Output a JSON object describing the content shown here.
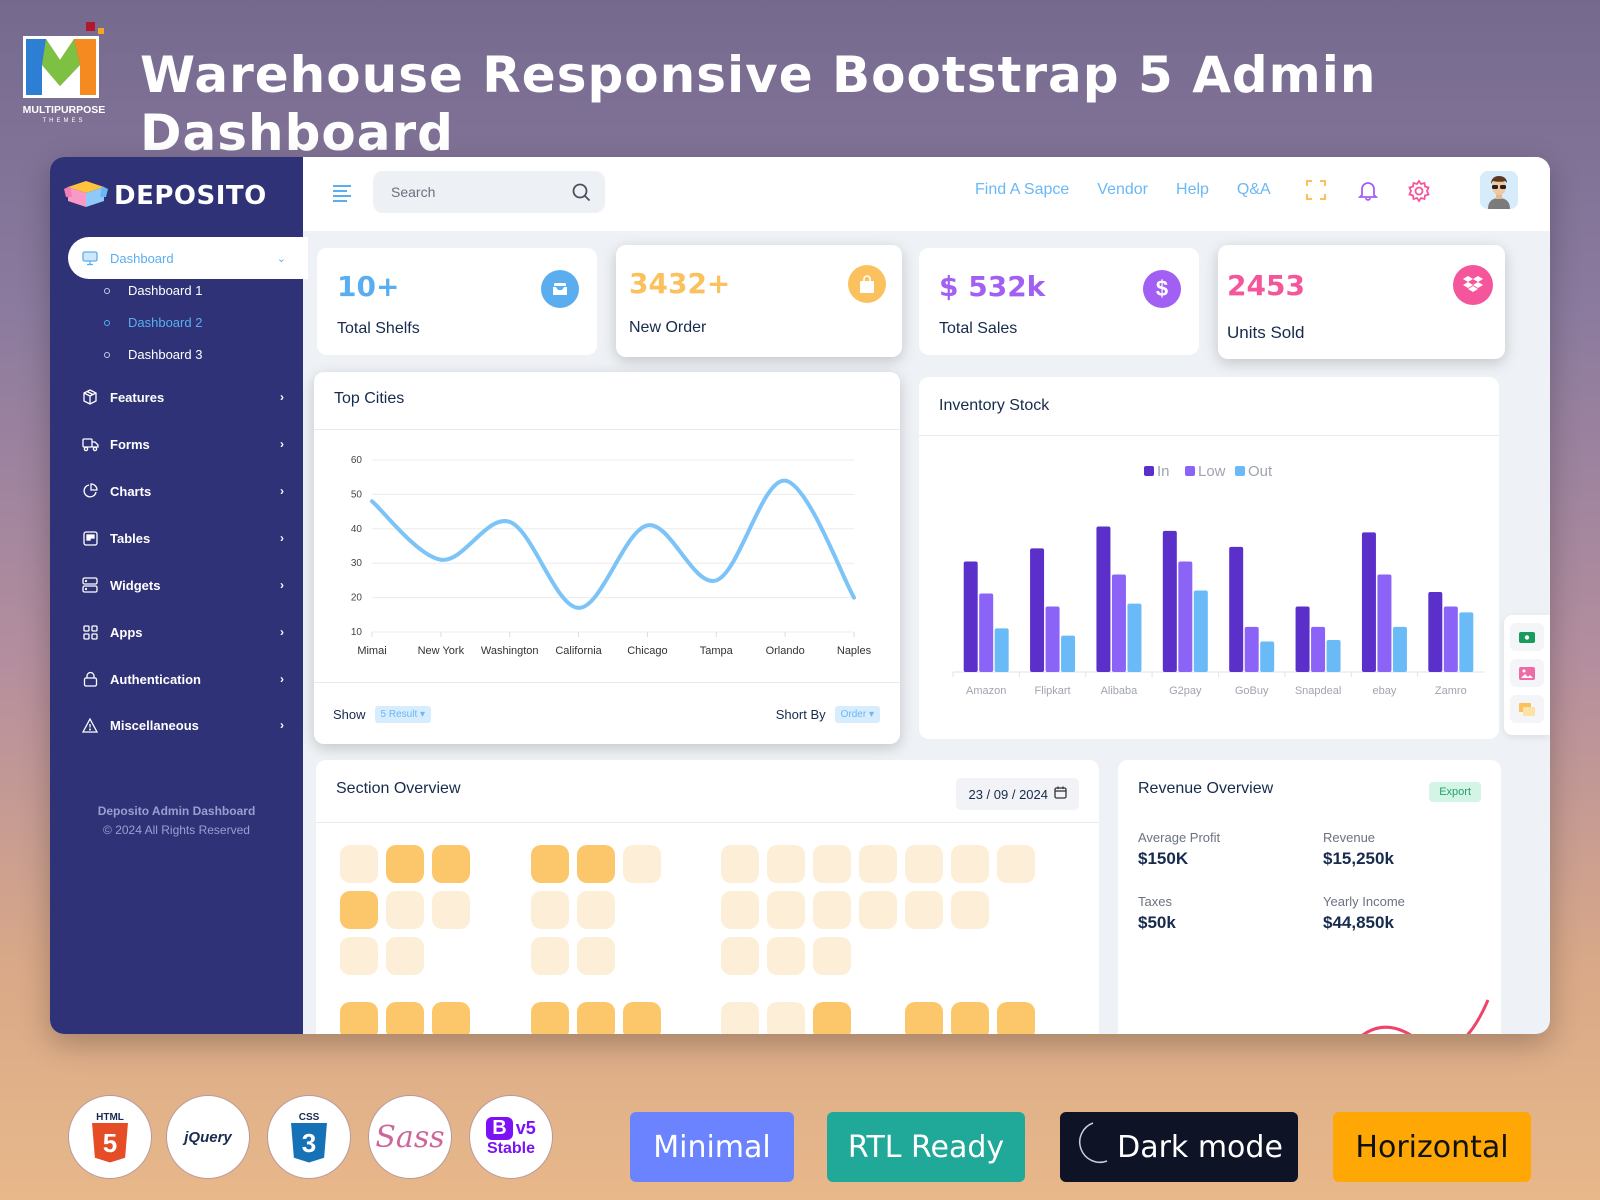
{
  "promo": {
    "brand_logo_text": "MULTIPURPOSE",
    "brand_logo_sub": "THEMES",
    "title": "Warehouse Responsive Bootstrap 5 Admin Dashboard",
    "tech_badges": [
      {
        "name": "HTML",
        "label": "HTML",
        "glyph": "5"
      },
      {
        "name": "jQuery",
        "label": "jQuery"
      },
      {
        "name": "CSS",
        "label": "CSS",
        "glyph": "3"
      },
      {
        "name": "Sass",
        "label": "Sass"
      },
      {
        "name": "Bootstrap",
        "label": "B",
        "version": "v5",
        "sub": "Stable"
      }
    ],
    "features": [
      {
        "label": "Minimal",
        "color": "#6c83ff"
      },
      {
        "label": "RTL Ready",
        "color": "#20a898"
      },
      {
        "label": "Dark mode",
        "color": "#0f1326"
      },
      {
        "label": "Horizontal",
        "color": "#ffa805"
      }
    ]
  },
  "sidebar": {
    "brand": "DEPOSITO",
    "active_item": "Dashboard",
    "sub_items": [
      {
        "label": "Dashboard 1",
        "active": false
      },
      {
        "label": "Dashboard 2",
        "active": true
      },
      {
        "label": "Dashboard 3",
        "active": false
      }
    ],
    "items": [
      {
        "label": "Features",
        "icon": "box-icon"
      },
      {
        "label": "Forms",
        "icon": "truck-icon"
      },
      {
        "label": "Charts",
        "icon": "pie-chart-icon"
      },
      {
        "label": "Tables",
        "icon": "table-icon"
      },
      {
        "label": "Widgets",
        "icon": "widgets-icon"
      },
      {
        "label": "Apps",
        "icon": "apps-grid-icon"
      },
      {
        "label": "Authentication",
        "icon": "lock-icon"
      },
      {
        "label": "Miscellaneous",
        "icon": "warning-icon"
      }
    ],
    "footer_title": "Deposito Admin Dashboard",
    "footer_copy": "© 2024 All Rights Reserved"
  },
  "topbar": {
    "search_placeholder": "Search",
    "links": [
      "Find A Sapce",
      "Vendor",
      "Help",
      "Q&A"
    ]
  },
  "stats": [
    {
      "value": "10+",
      "label": "Total Shelfs",
      "color": "#5aaef0"
    },
    {
      "value": "3432+",
      "label": "New Order",
      "color": "#fbc15e"
    },
    {
      "value": "$ 532k",
      "label": "Total Sales",
      "color": "#a25ff3"
    },
    {
      "value": "2453",
      "label": "Units Sold",
      "color": "#f5569b"
    }
  ],
  "top_cities": {
    "title": "Top Cities",
    "show_label": "Show",
    "show_value": "5 Result",
    "sort_label": "Short By",
    "sort_value": "Order"
  },
  "inventory": {
    "title": "Inventory Stock"
  },
  "section_overview": {
    "title": "Section Overview",
    "date": "23 / 09 / 2024"
  },
  "revenue": {
    "title": "Revenue Overview",
    "export_label": "Export",
    "metrics": [
      {
        "label": "Average Profit",
        "value": "$150K"
      },
      {
        "label": "Revenue",
        "value": "$15,250k"
      },
      {
        "label": "Taxes",
        "value": "$50k"
      },
      {
        "label": "Yearly Income",
        "value": "$44,850k"
      }
    ]
  },
  "chart_data": [
    {
      "type": "line",
      "title": "Top Cities",
      "categories": [
        "Mimai",
        "New York",
        "Washington",
        "California",
        "Chicago",
        "Tampa",
        "Orlando",
        "Naples"
      ],
      "values": [
        48,
        31,
        42,
        17,
        41,
        25,
        54,
        20
      ],
      "ylim": [
        10,
        60
      ],
      "yticks": [
        10,
        20,
        30,
        40,
        50,
        60
      ],
      "grid": true,
      "color": "#7cc3f7",
      "xlabel": "",
      "ylabel": ""
    },
    {
      "type": "bar",
      "title": "Inventory Stock",
      "categories": [
        "Amazon",
        "Flipkart",
        "Alibaba",
        "G2pay",
        "GoBuy",
        "Snapdeal",
        "ebay",
        "Zamro"
      ],
      "series": [
        {
          "name": "In",
          "color": "#5b2fc9",
          "values": [
            76,
            85,
            100,
            97,
            86,
            45,
            96,
            55
          ]
        },
        {
          "name": "Low",
          "color": "#8b63f6",
          "values": [
            54,
            45,
            67,
            76,
            31,
            31,
            67,
            45
          ]
        },
        {
          "name": "Out",
          "color": "#6bbaf8",
          "values": [
            30,
            25,
            47,
            56,
            21,
            22,
            31,
            41
          ]
        }
      ],
      "legend": "top-center",
      "ylim": [
        0,
        110
      ],
      "grid": false
    }
  ],
  "seat_map": {
    "blocks": [
      {
        "rows": [
          [
            0,
            1,
            1
          ],
          [
            1,
            0,
            0
          ],
          [
            0,
            0
          ]
        ]
      },
      {
        "rows": [
          [
            1,
            1,
            0
          ],
          [
            0,
            0
          ],
          [
            0,
            0
          ]
        ]
      },
      {
        "rows": [
          [
            0,
            0,
            0,
            0,
            0,
            0,
            0
          ],
          [
            0,
            0,
            0,
            0,
            0,
            0
          ],
          [
            0,
            0,
            0
          ]
        ]
      }
    ]
  }
}
